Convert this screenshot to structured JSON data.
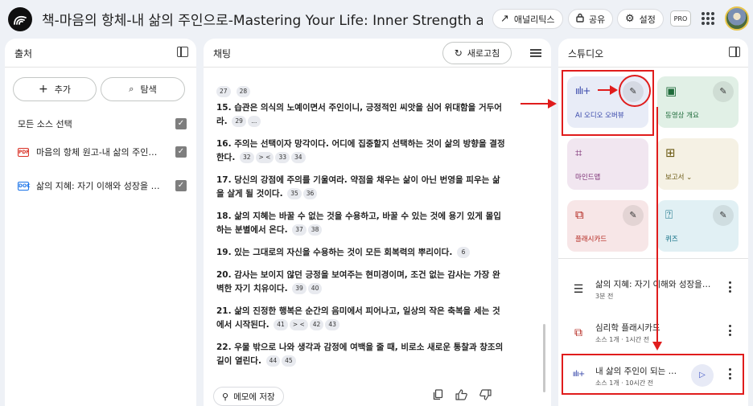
{
  "header": {
    "title": "책-마음의 항체-내 삶의 주인으로-Mastering Your Life:  Inner Strength and Self-Mastery",
    "analytics_label": "애널리틱스",
    "share_label": "공유",
    "settings_label": "설정",
    "pro_badge": "PRO"
  },
  "sources": {
    "title": "출처",
    "add_label": "추가",
    "explore_label": "탐색",
    "select_all_label": "모든 소스 선택",
    "items": [
      {
        "type": "PDF",
        "label": "마음의 항체 원고-내 삶의 주인으로-Mastering Your Life"
      },
      {
        "type": "DOC",
        "label": "삶의 지혜: 자기 이해와 성장을 위한 안내서"
      }
    ]
  },
  "chat": {
    "title": "채팅",
    "refresh_label": "새로고침",
    "top_cites": [
      "27",
      "28"
    ],
    "paragraphs": [
      {
        "text": "15. 습관은 의식의 노예이면서 주인이니, 긍정적인 씨앗을 심어 위대함을 거두어라.",
        "cites": [
          "29",
          "..."
        ]
      },
      {
        "text": "16. 주의는 선택이자 망각이다. 어디에 집중할지 선택하는 것이 삶의 방향을 결정한다.",
        "cites": [
          "32",
          "> <",
          "33",
          "34"
        ]
      },
      {
        "text": "17. 당신의 강점에 주의를 기울여라. 약점을 채우는 삶이 아닌 번영을 피우는 삶을 살게 될 것이다.",
        "cites": [
          "35",
          "36"
        ]
      },
      {
        "text": "18. 삶의 지혜는 바꿀 수 없는 것을 수용하고, 바꿀 수 있는 것에 용기 있게 몰입하는 분별에서 온다.",
        "cites": [
          "37",
          "38"
        ]
      },
      {
        "text": "19. 있는 그대로의 자신을 수용하는 것이 모든 회복력의 뿌리이다.",
        "cites": [
          "6"
        ]
      },
      {
        "text": "20. 감사는 보이지 않던 긍정을 보여주는 현미경이며, 조건 없는 감사는 가장 완벽한 자기 치유이다.",
        "cites": [
          "39",
          "40"
        ]
      },
      {
        "text": "21. 삶의 진정한 행복은 순간의 음미에서 피어나고, 일상의 작은 축복을 세는 것에서 시작된다.",
        "cites": [
          "41",
          "> <",
          "42",
          "43"
        ]
      },
      {
        "text": "22. 우물 밖으로 나와 생각과 감정에 여백을 줄 때, 비로소 새로운 통찰과 창조의 길이 열린다.",
        "cites": [
          "44",
          "45"
        ]
      }
    ],
    "save_memo_label": "메모에 저장"
  },
  "studio": {
    "title": "스튜디오",
    "tiles": [
      {
        "label": "AI 오디오 오버뷰",
        "icon": "audio-waveform-icon",
        "bg": "#e8ecf7",
        "color": "#3949ab"
      },
      {
        "label": "동영상 개요",
        "icon": "video-icon",
        "bg": "#e1f0e6",
        "color": "#1e6b3a"
      },
      {
        "label": "마인드맵",
        "icon": "mindmap-icon",
        "bg": "#f1e6f0",
        "color": "#7b2d73"
      },
      {
        "label": "보고서",
        "icon": "report-icon",
        "bg": "#f5f1e4",
        "color": "#6b5a14"
      },
      {
        "label": "플래시카드",
        "icon": "flashcard-icon",
        "bg": "#f7e6e7",
        "color": "#b3261e"
      },
      {
        "label": "퀴즈",
        "icon": "quiz-icon",
        "bg": "#e1f0f4",
        "color": "#0b6b82"
      }
    ],
    "notes": [
      {
        "title": "삶의 지혜: 자기 이해와 성장을 위한 안내서",
        "sub": "3분 전"
      },
      {
        "title": "심리학 플래시카드",
        "sub": "소스 1개 · 1시간 전"
      },
      {
        "title": "내 삶의 주인이 되는 법: 마음의 항체",
        "sub": "소스 1개 · 10시간 전"
      }
    ]
  },
  "colors": {
    "annotation": "#e01c1c",
    "panel_bg": "#ffffff",
    "page_bg": "#eef1f6"
  }
}
